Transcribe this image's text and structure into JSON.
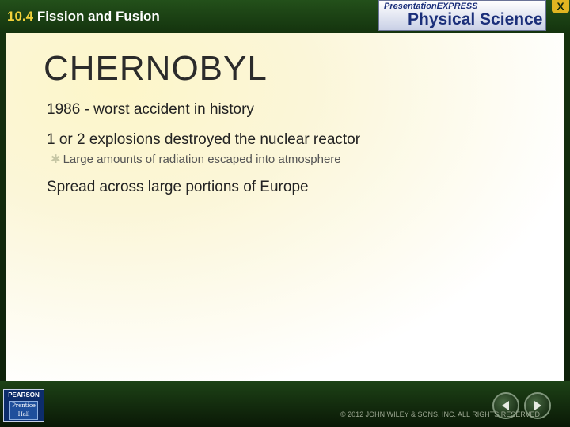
{
  "header": {
    "section_number": "10.4",
    "section_name": "Fission and Fusion",
    "logo_top": "PresentationEXPRESS",
    "logo_main": "Physical Science",
    "close_label": "X"
  },
  "slide": {
    "title": "CHERNOBYL",
    "bullets": [
      "1986 - worst accident in history",
      "1 or 2 explosions destroyed the nuclear reactor",
      "Large amounts of radiation escaped into atmosphere",
      "Spread across large portions of Europe"
    ]
  },
  "footer": {
    "publisher": "PEARSON",
    "imprint": "Prentice Hall",
    "copyright": "© 2012 JOHN WILEY & SONS, INC. ALL RIGHTS RESERVED.",
    "prev_icon": "triangle-left",
    "next_icon": "triangle-right"
  },
  "colors": {
    "accent": "#f2d23a",
    "frame": "#16330f",
    "logo_text": "#1b2f7a"
  }
}
